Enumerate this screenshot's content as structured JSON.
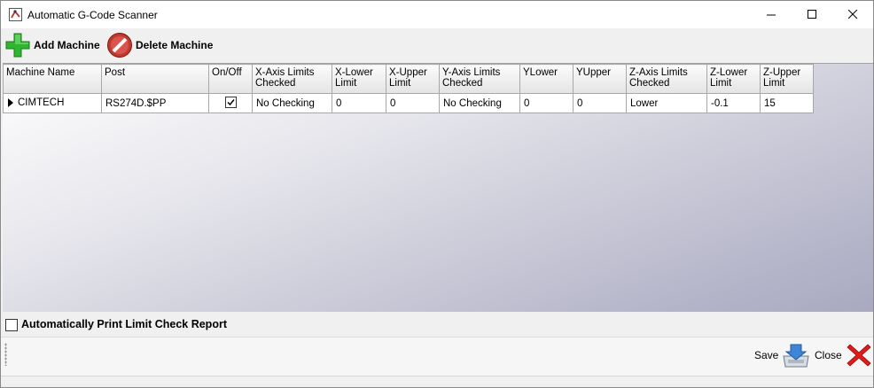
{
  "window": {
    "title": "Automatic G-Code Scanner"
  },
  "toolbar": {
    "add_label": "Add Machine",
    "delete_label": "Delete Machine"
  },
  "grid": {
    "columns": [
      "Machine Name",
      "Post",
      "On/Off",
      "X-Axis Limits Checked",
      "X-Lower Limit",
      "X-Upper Limit",
      "Y-Axis Limits Checked",
      "YLower",
      "YUpper",
      "Z-Axis Limits Checked",
      "Z-Lower Limit",
      "Z-Upper Limit"
    ],
    "rows": [
      {
        "machine_name": "CIMTECH",
        "post": "RS274D.$PP",
        "on_off": true,
        "x_checked": "No Checking",
        "x_lower": "0",
        "x_upper": "0",
        "y_checked": "No Checking",
        "y_lower": "0",
        "y_upper": "0",
        "z_checked": "Lower",
        "z_lower": "-0.1",
        "z_upper": "15"
      }
    ]
  },
  "options": {
    "auto_print_label": "Automatically Print Limit Check Report",
    "auto_print_checked": false
  },
  "footer": {
    "save_label": "Save",
    "close_label": "Close"
  }
}
